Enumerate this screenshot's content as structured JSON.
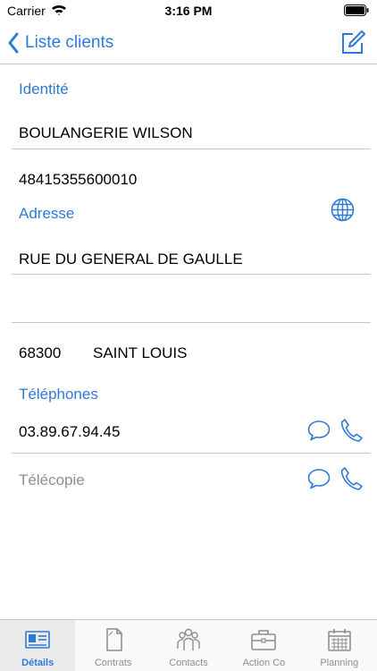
{
  "status_bar": {
    "carrier": "Carrier",
    "time": "3:16 PM"
  },
  "nav": {
    "back_label": "Liste clients"
  },
  "identity": {
    "header": "Identité",
    "name": "BOULANGERIE WILSON",
    "siret": "48415355600010"
  },
  "address": {
    "header": "Adresse",
    "line1": "RUE DU GENERAL DE GAULLE",
    "line2": "",
    "postal_code": "68300",
    "city": "SAINT LOUIS"
  },
  "phones": {
    "header": "Téléphones",
    "phone": "03.89.67.94.45",
    "fax_placeholder": "Télécopie"
  },
  "tabs": [
    {
      "label": "Détails",
      "icon": "id-card-icon",
      "active": true
    },
    {
      "label": "Contrats",
      "icon": "document-icon",
      "active": false
    },
    {
      "label": "Contacts",
      "icon": "people-icon",
      "active": false
    },
    {
      "label": "Action Co",
      "icon": "briefcase-icon",
      "active": false
    },
    {
      "label": "Planning",
      "icon": "calendar-icon",
      "active": false
    }
  ],
  "colors": {
    "accent": "#2f7ad6",
    "separator": "#c8c7cc",
    "inactive": "#8e8e93"
  }
}
